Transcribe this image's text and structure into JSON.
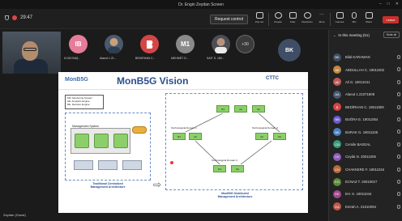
{
  "window": {
    "title": "Dr. Engin Zeydan Screen"
  },
  "toolbar": {
    "timer": "29:47",
    "request_control": "Request control",
    "tools": [
      {
        "name": "popout",
        "label": "Pop out"
      },
      {
        "name": "people",
        "label": "People"
      },
      {
        "name": "chat",
        "label": "Chat"
      },
      {
        "name": "reactions",
        "label": "Reactions"
      },
      {
        "name": "more",
        "label": "More"
      },
      {
        "name": "camera",
        "label": "Camera"
      },
      {
        "name": "mic",
        "label": "Mic"
      },
      {
        "name": "share",
        "label": "Share"
      }
    ],
    "leave": "Leave"
  },
  "strip": {
    "participants": [
      {
        "initials": "IB",
        "name": "İLYAS BAŞ...",
        "color": "#e57d9a"
      },
      {
        "initials": "",
        "name": "Alaeut 1.21...",
        "color": "#4a5a6e"
      },
      {
        "initials": "",
        "name": "BEDİRHAN C...",
        "color": "#d64545"
      },
      {
        "initials": "M1",
        "name": "MEHMET D...",
        "color": "#8a8a8a"
      },
      {
        "initials": "",
        "name": "SAİT S. 180...",
        "color": "#4b4e55"
      }
    ],
    "more_count": "+30",
    "spotlight_initials": "BK"
  },
  "slide": {
    "logo": "MonB5G",
    "title": "MonB5G Vision",
    "brand": "CTTC",
    "legend_lines": [
      "MS: Monitoring System",
      "AE: Analytics Engine",
      "DE: Decision Engine"
    ],
    "left_caption": [
      "Traditional Centralized",
      "Management Architecture"
    ],
    "right_caption": [
      "MonB5G Distributed",
      "Management Architecture"
    ],
    "mgmt_label": "Management System",
    "domain_labels": [
      "Technological Domain 1",
      "Technological Domain 2",
      "Technological Domain 3"
    ],
    "node_labels": [
      "MS",
      "AE",
      "DE"
    ]
  },
  "presenter": {
    "name": "Zeydan (Guest)"
  },
  "panel": {
    "header": "In this meeting (51)",
    "mute_all": "Mute all",
    "people": [
      {
        "initials": "BK",
        "name": "Bilal KARAMAN",
        "color": "#3f4e66"
      },
      {
        "initials": "AK",
        "name": "ABDULLAH C. 19011002",
        "color": "#c08a3e"
      },
      {
        "initials": "AK",
        "name": "Ali G. 18011041",
        "color": "#c05a5a"
      },
      {
        "initials": "AA",
        "name": "Alaeut 1.21071808",
        "color": "#4a5a6e"
      },
      {
        "initials": "B",
        "name": "BEDİRHAN C. 19011809",
        "color": "#d64545"
      },
      {
        "initials": "BB",
        "name": "BUĞRA E. 19011054",
        "color": "#6a5acd"
      },
      {
        "initials": "BK",
        "name": "BURAK G. 19011105",
        "color": "#4a7fc0"
      },
      {
        "initials": "CB",
        "name": "Cemile BASDAL",
        "color": "#3a9a7a"
      },
      {
        "initials": "CK",
        "name": "Ceyda N. 20011005",
        "color": "#8e5ab8"
      },
      {
        "initials": "CH",
        "name": "CHAKKERE F. 18011016",
        "color": "#b86a3a"
      },
      {
        "initials": "EG",
        "name": "ECNAZ T. 20010027",
        "color": "#5a8a3a"
      },
      {
        "initials": "EK",
        "name": "EH. K. 19011044",
        "color": "#a04a8a"
      },
      {
        "initials": "EA",
        "name": "Emrah A. 21010094",
        "color": "#c0564a"
      }
    ]
  }
}
